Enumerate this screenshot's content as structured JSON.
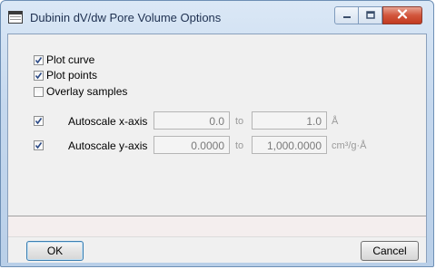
{
  "window": {
    "title": "Dubinin dV/dw Pore Volume Options"
  },
  "options": {
    "plot_curve": {
      "label": "Plot curve",
      "checked": true
    },
    "plot_points": {
      "label": "Plot points",
      "checked": true
    },
    "overlay_samples": {
      "label": "Overlay samples",
      "checked": false
    }
  },
  "x_axis": {
    "checked": true,
    "label": "Autoscale x-axis",
    "from": "0.0",
    "to_label": "to",
    "to": "1.0",
    "unit": "Å"
  },
  "y_axis": {
    "checked": true,
    "label": "Autoscale y-axis",
    "from": "0.0000",
    "to_label": "to",
    "to": "1,000.0000",
    "unit": "cm³/g·Å"
  },
  "buttons": {
    "ok": "OK",
    "cancel": "Cancel"
  },
  "colors": {
    "title_text": "#1e3050",
    "close_button": "#c94a33",
    "check_mark": "#2b4a86"
  }
}
